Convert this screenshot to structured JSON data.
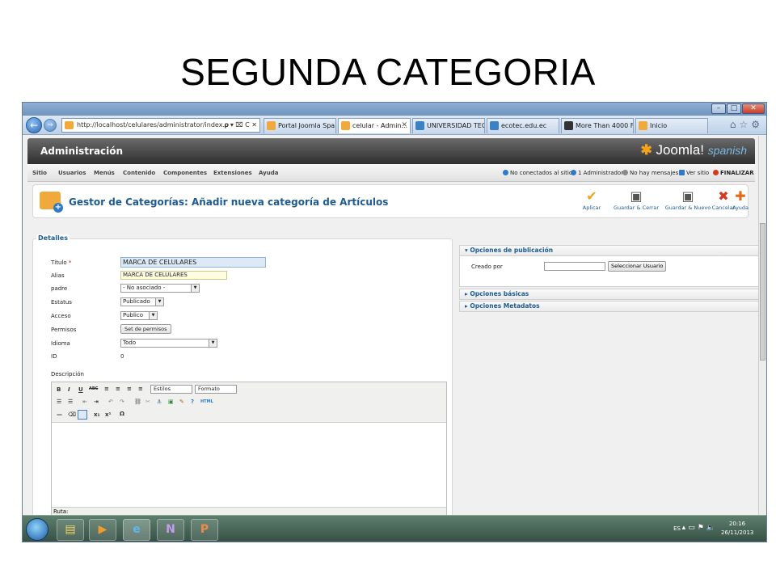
{
  "slide": {
    "title": "SEGUNDA CATEGORIA"
  },
  "browser": {
    "window_title": "",
    "address": "http://localhost/celulares/administrator/index.p",
    "address_controls": "ρ ▾ ⌧ C ✕",
    "tabs": [
      {
        "label": "Portal Joomla Spa...",
        "active": false,
        "icon_color": "#f0a93a"
      },
      {
        "label": "celular - Admin...",
        "active": true,
        "icon_color": "#f0a93a"
      },
      {
        "label": "UNIVERSIDAD TEC...",
        "active": false,
        "icon_color": "#3b82c4"
      },
      {
        "label": "ecotec.edu.ec",
        "active": false,
        "icon_color": "#3b82c4"
      },
      {
        "label": "More Than 4000 Fr...",
        "active": false,
        "icon_color": "#333333"
      },
      {
        "label": "Inicio",
        "active": false,
        "icon_color": "#f0a93a"
      }
    ]
  },
  "admin": {
    "header_title": "Administración",
    "logo_text": "Joomla!",
    "logo_suffix": "spanish",
    "menu": [
      "Sitio",
      "Usuarios",
      "Menús",
      "Contenido",
      "Componentes",
      "Extensiones",
      "Ayuda"
    ],
    "status": [
      {
        "label": "No conectados al sitio",
        "color": "#2f79c5"
      },
      {
        "label": "1 Administrador",
        "color": "#2f79c5"
      },
      {
        "label": "No hay mensajes",
        "color": "#8a8a8a"
      },
      {
        "label": "Ver sitio",
        "color": "#2f79c5"
      },
      {
        "label": "FINALIZAR",
        "color": "#d43a1f"
      }
    ]
  },
  "toolbar": {
    "page_title": "Gestor de Categorías: Añadir nueva categoría de Artículos",
    "buttons": [
      {
        "label": "Aplicar",
        "icon": "check-icon",
        "glyph": "✔",
        "color": "#f0a21b"
      },
      {
        "label": "Guardar & Cerrar",
        "icon": "save-close-icon",
        "glyph": "💾",
        "color": "#555555"
      },
      {
        "label": "Guardar & Nuevo",
        "icon": "save-new-icon",
        "glyph": "💾",
        "color": "#555555"
      },
      {
        "label": "Cancelar",
        "icon": "cancel-icon",
        "glyph": "✖",
        "color": "#d43a1f"
      },
      {
        "label": "Ayuda",
        "icon": "help-icon",
        "glyph": "✚",
        "color": "#e06a1a"
      }
    ]
  },
  "details": {
    "legend": "Detalles",
    "fields": {
      "titulo_label": "Título",
      "titulo_value": "MARCA DE CELULARES",
      "alias_label": "Alias",
      "alias_value": "MARCA DE CELULARES",
      "padre_label": "padre",
      "padre_value": "- No asociado -",
      "estatus_label": "Estatus",
      "estatus_value": "Publicado",
      "acceso_label": "Acceso",
      "acceso_value": "Publico",
      "permisos_label": "Permisos",
      "permisos_button": "Set de permisos",
      "idioma_label": "Idioma",
      "idioma_value": "Todo",
      "id_label": "ID",
      "id_value": "0",
      "descripcion_label": "Descripción"
    },
    "editor": {
      "styles_select": "Estilos",
      "format_select": "Formato",
      "path_label": "Ruta:"
    }
  },
  "options": {
    "publication": "Opciones de publicación",
    "creado_por": "Creado por",
    "select_user": "Seleccionar Usuario",
    "basic": "Opciones básicas",
    "metadata": "Opciones Metadatos"
  },
  "taskbar": {
    "lang": "ES",
    "time": "20:16",
    "date": "26/11/2013"
  }
}
